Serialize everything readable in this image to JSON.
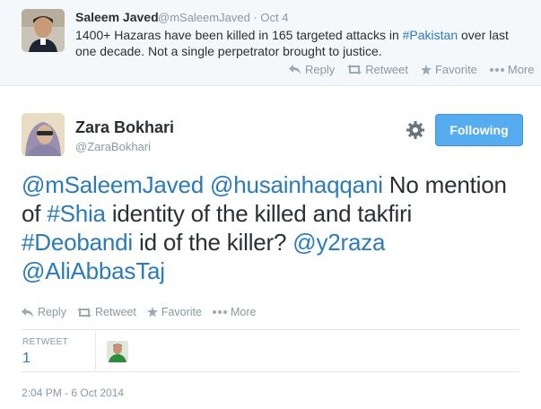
{
  "parent_tweet": {
    "name": "Saleem Javed",
    "handle": "@mSaleemJaved",
    "time": "Oct 4",
    "text_before": "1400+ Hazaras have been killed in 165 targeted attacks in ",
    "hashtag": "#Pakistan",
    "text_after": " over last one decade. Not a single perpetrator brought to justice.",
    "actions": {
      "reply": "Reply",
      "retweet": "Retweet",
      "favorite": "Favorite",
      "more": "More"
    }
  },
  "main_tweet": {
    "name": "Zara Bokhari",
    "handle": "@ZaraBokhari",
    "follow_label": "Following",
    "text": {
      "m1": "@mSaleemJaved",
      "sp1": " ",
      "m2": "@husainhaqqani",
      "t1": " No mention of ",
      "h1": "#Shia",
      "t2": " identity of the killed and takfiri ",
      "h2": "#Deobandi",
      "t3": " id of the killer? ",
      "m3": "@y2raza",
      "sp2": " ",
      "m4": "@AliAbbasTaj"
    },
    "actions": {
      "reply": "Reply",
      "retweet": "Retweet",
      "favorite": "Favorite",
      "more": "More"
    },
    "stats": {
      "retweet_label": "RETWEET",
      "retweet_count": "1"
    },
    "timestamp": "2:04 PM - 6 Oct 2014"
  },
  "colors": {
    "link": "#2b7bb9",
    "follow_button": "#55acee",
    "muted": "#8899a6",
    "parent_bg": "#f5f8fa"
  },
  "icons": [
    "reply-icon",
    "retweet-icon",
    "favorite-icon",
    "more-icon",
    "gear-icon"
  ]
}
